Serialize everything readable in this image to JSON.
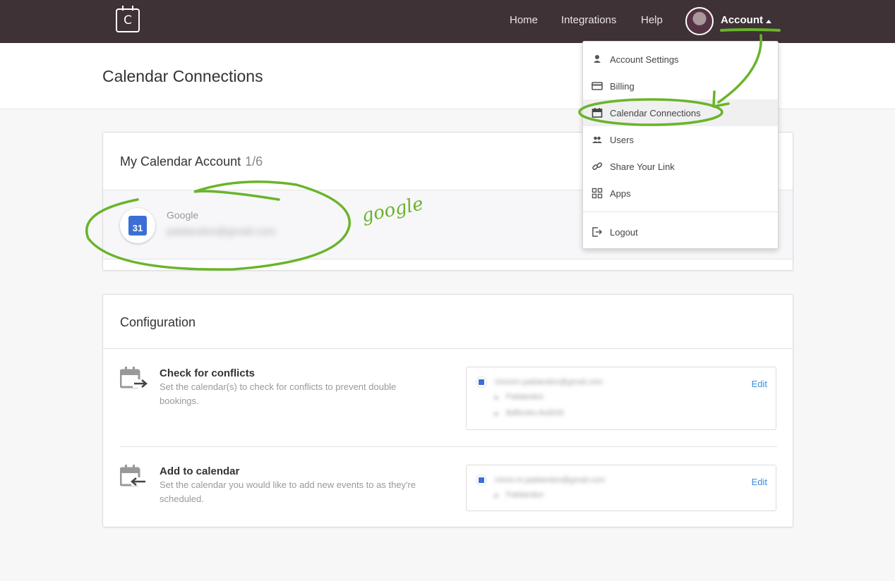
{
  "nav": {
    "logo_letter": "C",
    "links": [
      "Home",
      "Integrations",
      "Help"
    ],
    "account_label": "Account"
  },
  "page": {
    "title": "Calendar Connections"
  },
  "calendar_account": {
    "title": "My Calendar Account",
    "count": "1/6",
    "provider": "Google",
    "email": "patdandon@gmail.com",
    "icon_number": "31"
  },
  "configuration": {
    "title": "Configuration",
    "check": {
      "title": "Check for conflicts",
      "description": "Set the calendar(s) to check for conflicts to prevent double bookings.",
      "account": "mmmm.patdandon@gmail.com",
      "calendars": [
        "Patdandon",
        "Bdfhc9m-llvd205"
      ],
      "edit": "Edit"
    },
    "add": {
      "title": "Add to calendar",
      "description": "Set the calendar you would like to add new events to as they're scheduled.",
      "account": "mmm.m.patdandon@gmail.com",
      "calendars": [
        "Patdandon"
      ],
      "edit": "Edit"
    }
  },
  "dropdown": {
    "items": [
      "Account Settings",
      "Billing",
      "Calendar Connections",
      "Users",
      "Share Your Link",
      "Apps"
    ],
    "logout": "Logout",
    "active_index": 2
  },
  "annotation": {
    "word": "google",
    "color": "#6ab42a"
  }
}
